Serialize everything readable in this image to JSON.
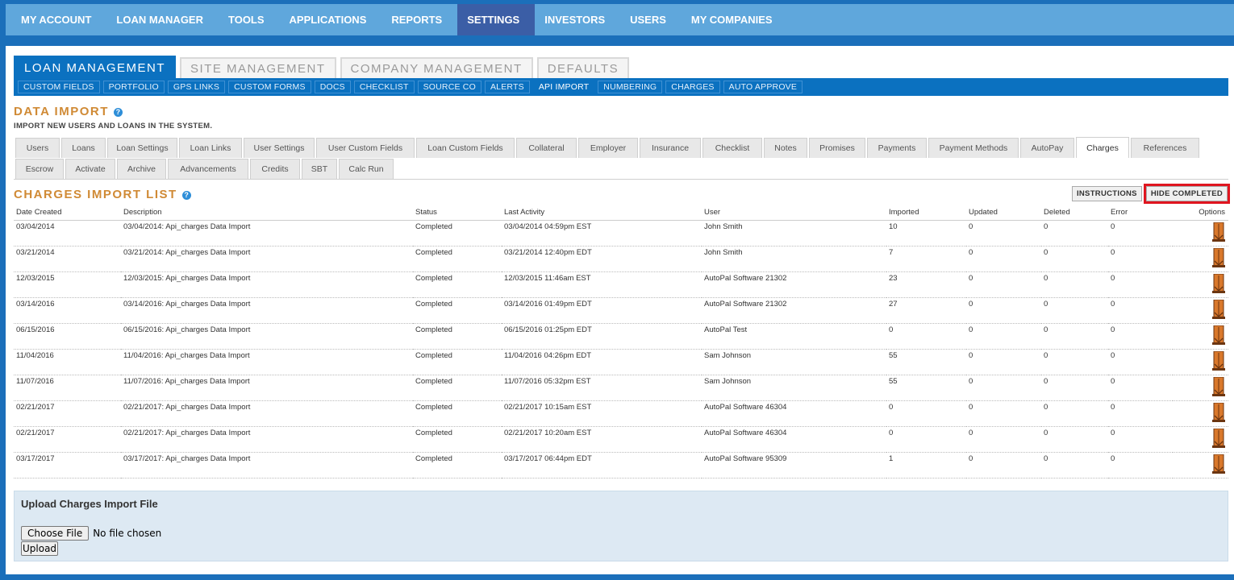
{
  "topnav": {
    "items": [
      {
        "label": "MY ACCOUNT",
        "name": "nav-my-account"
      },
      {
        "label": "LOAN MANAGER",
        "name": "nav-loan-manager"
      },
      {
        "label": "TOOLS",
        "name": "nav-tools"
      },
      {
        "label": "APPLICATIONS",
        "name": "nav-applications"
      },
      {
        "label": "REPORTS",
        "name": "nav-reports"
      },
      {
        "label": "SETTINGS",
        "name": "nav-settings",
        "active": true
      },
      {
        "label": "INVESTORS",
        "name": "nav-investors"
      },
      {
        "label": "USERS",
        "name": "nav-users"
      },
      {
        "label": "MY COMPANIES",
        "name": "nav-my-companies"
      }
    ]
  },
  "section_tabs": [
    {
      "label": "LOAN MANAGEMENT",
      "active": true
    },
    {
      "label": "SITE MANAGEMENT"
    },
    {
      "label": "COMPANY MANAGEMENT"
    },
    {
      "label": "DEFAULTS"
    }
  ],
  "subnav": [
    {
      "label": "CUSTOM FIELDS"
    },
    {
      "label": "PORTFOLIO"
    },
    {
      "label": "GPS LINKS"
    },
    {
      "label": "CUSTOM FORMS"
    },
    {
      "label": "DOCS"
    },
    {
      "label": "CHECKLIST"
    },
    {
      "label": "SOURCE CO"
    },
    {
      "label": "ALERTS"
    },
    {
      "label": "API IMPORT",
      "active": true
    },
    {
      "label": "NUMBERING"
    },
    {
      "label": "CHARGES"
    },
    {
      "label": "AUTO APPROVE"
    }
  ],
  "data_import": {
    "title": "DATA IMPORT",
    "subtitle": "IMPORT NEW USERS AND LOANS IN THE SYSTEM.",
    "help": "?"
  },
  "import_tabs": {
    "row1": [
      {
        "label": "Users"
      },
      {
        "label": "Loans"
      },
      {
        "label": "Loan Settings"
      },
      {
        "label": "Loan Links"
      },
      {
        "label": "User Settings"
      },
      {
        "label": "User Custom Fields"
      },
      {
        "label": "Loan Custom Fields"
      },
      {
        "label": "Collateral"
      },
      {
        "label": "Employer"
      },
      {
        "label": "Insurance"
      },
      {
        "label": "Checklist"
      },
      {
        "label": "Notes"
      },
      {
        "label": "Promises"
      },
      {
        "label": "Payments"
      },
      {
        "label": "Payment Methods"
      },
      {
        "label": "AutoPay"
      },
      {
        "label": "Charges",
        "active": true
      },
      {
        "label": "References"
      }
    ],
    "row2": [
      {
        "label": "Escrow"
      },
      {
        "label": "Activate"
      },
      {
        "label": "Archive"
      },
      {
        "label": "Advancements"
      },
      {
        "label": "Credits"
      },
      {
        "label": "SBT"
      },
      {
        "label": "Calc Run"
      }
    ]
  },
  "charges_list": {
    "title": "CHARGES IMPORT LIST",
    "help": "?",
    "instructions_label": "INSTRUCTIONS",
    "hide_completed_label": "HIDE COMPLETED",
    "columns": [
      "Date Created",
      "Description",
      "Status",
      "Last Activity",
      "User",
      "Imported",
      "Updated",
      "Deleted",
      "Error",
      "Options"
    ],
    "rows": [
      [
        "03/04/2014",
        "03/04/2014: Api_charges Data Import",
        "Completed",
        "03/04/2014 04:59pm EST",
        "John Smith",
        "10",
        "0",
        "0",
        "0"
      ],
      [
        "03/21/2014",
        "03/21/2014: Api_charges Data Import",
        "Completed",
        "03/21/2014 12:40pm EDT",
        "John Smith",
        "7",
        "0",
        "0",
        "0"
      ],
      [
        "12/03/2015",
        "12/03/2015: Api_charges Data Import",
        "Completed",
        "12/03/2015 11:46am EST",
        "AutoPal Software 21302",
        "23",
        "0",
        "0",
        "0"
      ],
      [
        "03/14/2016",
        "03/14/2016: Api_charges Data Import",
        "Completed",
        "03/14/2016 01:49pm EDT",
        "AutoPal Software 21302",
        "27",
        "0",
        "0",
        "0"
      ],
      [
        "06/15/2016",
        "06/15/2016: Api_charges Data Import",
        "Completed",
        "06/15/2016 01:25pm EDT",
        "AutoPal Test",
        "0",
        "0",
        "0",
        "0"
      ],
      [
        "11/04/2016",
        "11/04/2016: Api_charges Data Import",
        "Completed",
        "11/04/2016 04:26pm EDT",
        "Sam Johnson",
        "55",
        "0",
        "0",
        "0"
      ],
      [
        "11/07/2016",
        "11/07/2016: Api_charges Data Import",
        "Completed",
        "11/07/2016 05:32pm EST",
        "Sam Johnson",
        "55",
        "0",
        "0",
        "0"
      ],
      [
        "02/21/2017",
        "02/21/2017: Api_charges Data Import",
        "Completed",
        "02/21/2017 10:15am EST",
        "AutoPal Software 46304",
        "0",
        "0",
        "0",
        "0"
      ],
      [
        "02/21/2017",
        "02/21/2017: Api_charges Data Import",
        "Completed",
        "02/21/2017 10:20am EST",
        "AutoPal Software 46304",
        "0",
        "0",
        "0",
        "0"
      ],
      [
        "03/17/2017",
        "03/17/2017: Api_charges Data Import",
        "Completed",
        "03/17/2017 06:44pm EDT",
        "AutoPal Software 95309",
        "1",
        "0",
        "0",
        "0"
      ]
    ],
    "options_icon": "options-menu-icon"
  },
  "upload": {
    "title": "Upload Charges Import File",
    "choose_label": "Choose File",
    "file_status": "No file chosen",
    "upload_label": "Upload"
  },
  "colors": {
    "page_bg": "#1b6fba",
    "topnav_bg": "#5fa7dc",
    "topnav_active": "#3b5ea6",
    "primary_blue": "#0b71c0",
    "orange_title": "#d08a35",
    "highlight_red": "#e0151f",
    "upload_bg": "#dde9f3"
  }
}
